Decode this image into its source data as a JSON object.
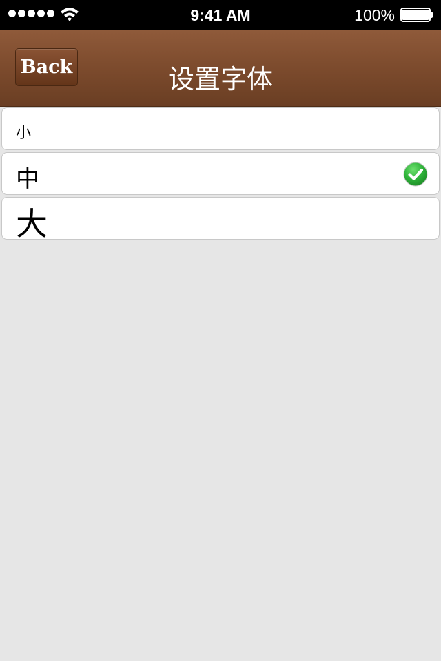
{
  "status_bar": {
    "time": "9:41 AM",
    "battery": "100%",
    "signal_dots": 5
  },
  "nav": {
    "back_label": "Back",
    "title": "设置字体"
  },
  "font_options": [
    {
      "label": "小",
      "selected": false
    },
    {
      "label": "中",
      "selected": true
    },
    {
      "label": "大",
      "selected": false
    }
  ],
  "colors": {
    "nav_brown": "#7e4c2e",
    "background": "#e6e6e6",
    "check_green": "#2fb33a"
  },
  "icons": {
    "selected": "green-checkmark-icon"
  }
}
